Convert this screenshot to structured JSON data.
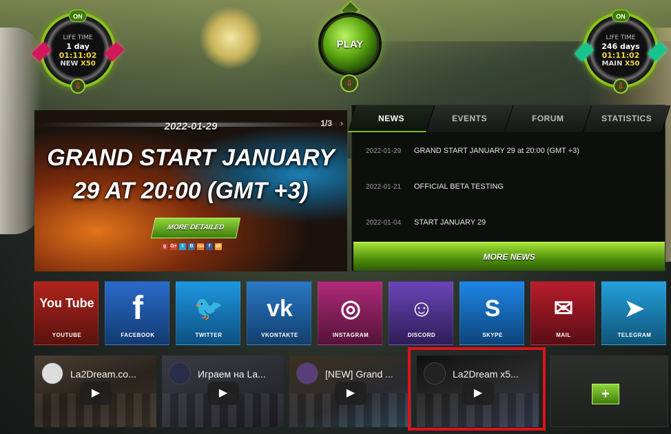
{
  "gauge_left": {
    "on": "ON",
    "line1": "LIFE TIME",
    "line2": "1 day",
    "line3": "01:11:02",
    "line4_a": "NEW",
    "line4_b": "X50"
  },
  "gauge_right": {
    "on": "ON",
    "line1": "LIFE TIME",
    "line2": "246 days",
    "line3": "01:11:02",
    "line4_a": "MAIN",
    "line4_b": "X50"
  },
  "play_label": "PLAY",
  "slider": {
    "date": "2022-01-29",
    "counter": "1/3",
    "arrow": "›",
    "title_line1": "GRAND START JANUARY",
    "title_line2": "29 AT 20:00 (GMT +3)",
    "more_label": "MORE DETAILED",
    "share_icons": [
      "g",
      "G+",
      "t",
      "B",
      "rss",
      "f",
      "ok"
    ]
  },
  "news": {
    "tabs": [
      "NEWS",
      "EVENTS",
      "FORUM",
      "STATISTICS"
    ],
    "items": [
      {
        "date": "2022-01-29",
        "title": "GRAND START JANUARY 29 at 20:00 (GMT +3)"
      },
      {
        "date": "2022-01-21",
        "title": "OFFICIAL BETA TESTING"
      },
      {
        "date": "2022-01-04",
        "title": "START JANUARY 29"
      }
    ],
    "more_label": "MORE NEWS"
  },
  "social": [
    {
      "label": "YOUTUBE",
      "icon": "You Tube",
      "color": "#8d1c16"
    },
    {
      "label": "FACEBOOK",
      "icon": "f",
      "color": "#1d4f98"
    },
    {
      "label": "TWITTER",
      "icon": "🐦",
      "color": "#1579b8"
    },
    {
      "label": "VKONTAKTE",
      "icon": "vk",
      "color": "#1f5d9a"
    },
    {
      "label": "INSTAGRAM",
      "icon": "◎",
      "color": "#8a1f5c"
    },
    {
      "label": "DISCORD",
      "icon": "☺",
      "color": "#4a2f86"
    },
    {
      "label": "SKYPE",
      "icon": "S",
      "color": "#1767b6"
    },
    {
      "label": "MAIL",
      "icon": "✉",
      "color": "#8c1320"
    },
    {
      "label": "TELEGRAM",
      "icon": "➤",
      "color": "#1b7db0"
    }
  ],
  "videos": [
    {
      "title": "La2Dream.co..."
    },
    {
      "title": "Играем на La..."
    },
    {
      "title": "[NEW] Grand ..."
    },
    {
      "title": "La2Dream x5..."
    }
  ],
  "add_label": "+"
}
